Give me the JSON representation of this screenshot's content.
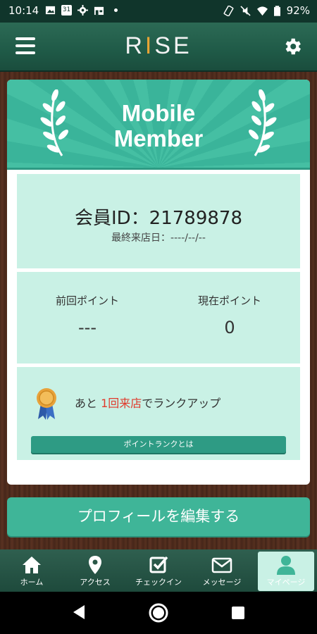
{
  "status_bar": {
    "time": "10:14",
    "calendar_day": "31",
    "battery": "92%",
    "left_icons": [
      "image-icon",
      "calendar-icon",
      "settings-icon",
      "store-icon",
      "dot-icon"
    ],
    "right_icons": [
      "screen-rotate-icon",
      "mute-icon",
      "wifi-icon",
      "battery-icon"
    ]
  },
  "header": {
    "logo_left": "R",
    "logo_bar": "I",
    "logo_right": "SE"
  },
  "card": {
    "title_line1": "Mobile",
    "title_line2": "Member",
    "member_id": "会員ID：21789878",
    "last_visit": "最終来店日：----/--/--",
    "points": {
      "previous_label": "前回ポイント",
      "previous_value": "---",
      "current_label": "現在ポイント",
      "current_value": "0"
    },
    "rank": {
      "text_before": "あと",
      "text_highlight": "1回来店",
      "text_after": "でランクアップ",
      "button_label": "ポイントランクとは"
    }
  },
  "edit_profile_button": "プロフィールを編集する",
  "bottom_nav": [
    {
      "label": "ホーム",
      "icon": "home-icon"
    },
    {
      "label": "アクセス",
      "icon": "map-pin-icon"
    },
    {
      "label": "チェックイン",
      "icon": "checkbox-icon"
    },
    {
      "label": "メッセージ",
      "icon": "mail-icon"
    },
    {
      "label": "マイページ",
      "icon": "user-icon"
    }
  ],
  "colors": {
    "accent": "#3fb598",
    "panel": "#c9f1e5",
    "header": "#1f5a47",
    "highlight": "#e03a2c"
  }
}
